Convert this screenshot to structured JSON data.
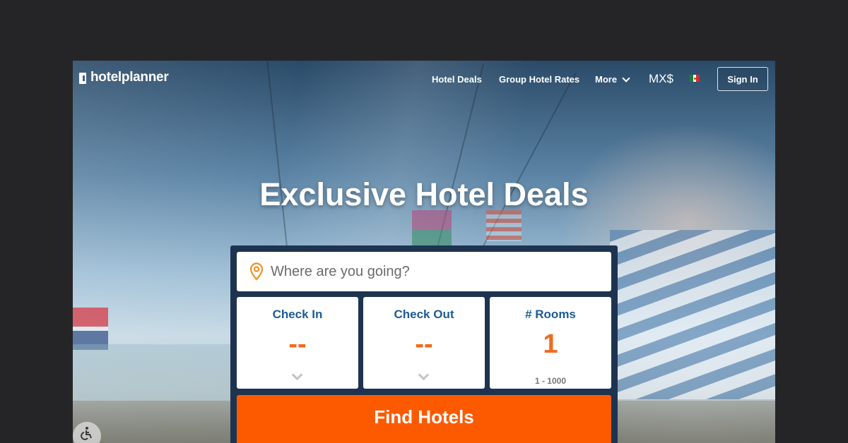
{
  "brand": {
    "name": "hotelplanner"
  },
  "nav": {
    "links": [
      "Hotel Deals",
      "Group Hotel Rates"
    ],
    "more_label": "More",
    "currency": "MX$",
    "flag_icon": "mexico-flag-icon",
    "sign_in": "Sign In"
  },
  "hero": {
    "title": "Exclusive Hotel Deals"
  },
  "search": {
    "placeholder": "Where are you going?",
    "value": ""
  },
  "fields": {
    "check_in": {
      "label": "Check In",
      "value": "--"
    },
    "check_out": {
      "label": "Check Out",
      "value": "--"
    },
    "rooms": {
      "label": "# Rooms",
      "value": "1",
      "range": "1 - 1000"
    }
  },
  "cta": {
    "find_label": "Find Hotels"
  },
  "colors": {
    "accent": "#fd5a00",
    "panel": "#1d3350",
    "label_blue": "#1b5b96",
    "value_orange": "#f26a1b"
  }
}
